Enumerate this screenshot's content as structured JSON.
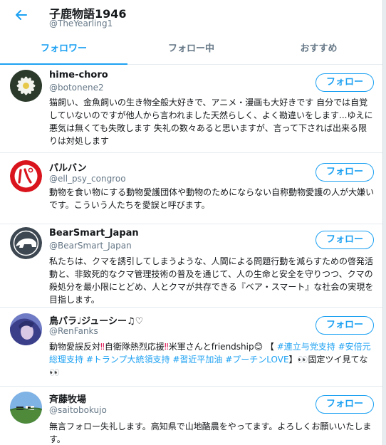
{
  "header": {
    "back_icon": "arrow-left-icon",
    "title": "子鹿物語1946",
    "handle": "@TheYearling1"
  },
  "tabs": [
    {
      "label": "フォロワー",
      "active": true
    },
    {
      "label": "フォロー中",
      "active": false
    },
    {
      "label": "おすすめ",
      "active": false
    }
  ],
  "accent_color": "#1da1f2",
  "follow_label": "フォロー",
  "users": [
    {
      "name": "hime-choro",
      "handle": "@botonene2",
      "bio": "猫飼い、金魚飼いの生き物全般大好きで、アニメ・漫画も大好きです 自分では自覚していないのですが他人から言われました天然らしく、よく勘違いをします...ゆえに悪気は無くても失敗します 失礼の数々あると思いますが、言って下されば出来る限りは対処します"
    },
    {
      "name": "パルバン",
      "handle": "@ell_psy_congroo",
      "bio": "動物を食い物にする動物愛護団体や動物のためにならない自称動物愛護の人が大嫌いです。こういう人たちを愛誤と呼びます。"
    },
    {
      "name": "BearSmart_Japan",
      "handle": "@BearSmart_Japan",
      "bio": "私たちは、クマを誘引してしまうような、人間による問題行動を減らすための啓発活動と、非致死的なクマ管理技術の普及を通じて、人の生命と安全を守りつつ、クマの殺処分を最小限にとどめ、人とクマが共存できる『ベア・スマート』な社会の実現を目指します。"
    },
    {
      "name": "鳥パラ♩ジューシー♫♡",
      "handle": "@RenFanks",
      "bio_parts": {
        "p1": "動物愛誤反対",
        "p2": "‼",
        "p3": "自衛隊熱烈応援",
        "p4": "‼",
        "p5": "米軍さんとfriendship😊 【 ",
        "p6": "#連立与党支持 #安倍元総理支持 #トランプ大統領支持 #習近平加油 #プーチンLOVE",
        "p7": "】👀固定ツイ見てな👀"
      }
    },
    {
      "name": "斉藤牧場",
      "handle": "@saitobokujo",
      "bio": "無言フォロー失礼します。高知県で山地酪農をやってます。よろしくお願いいたします。"
    }
  ]
}
